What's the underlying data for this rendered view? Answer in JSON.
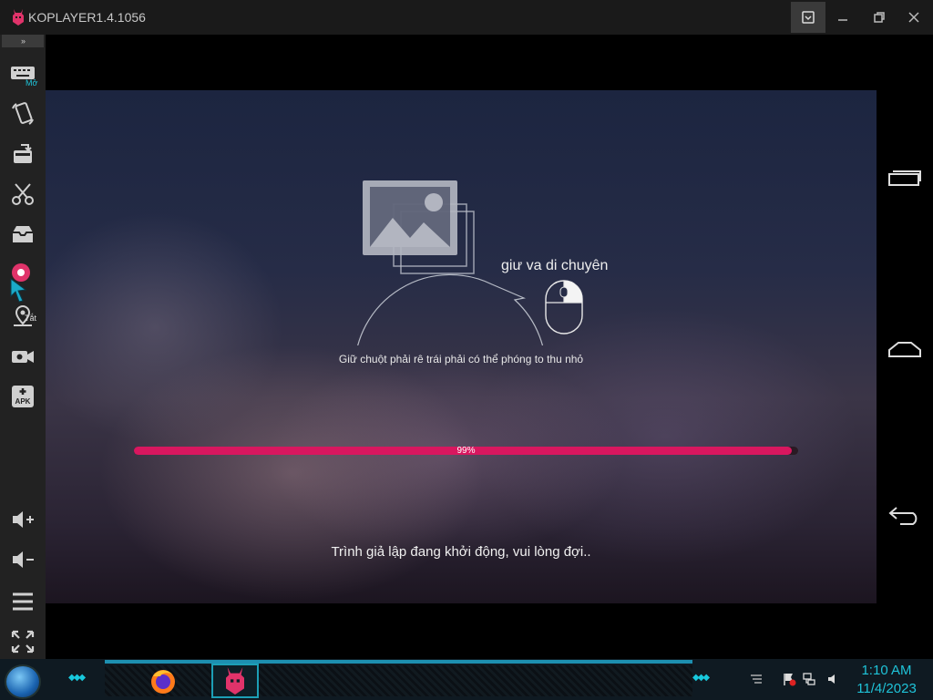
{
  "window": {
    "title": "KOPLAYER1.4.1056"
  },
  "sidebar": {
    "collapse_label": "››",
    "items": [
      {
        "name": "keyboard",
        "badge": "Mở"
      },
      {
        "name": "rotate"
      },
      {
        "name": "screen-switch"
      },
      {
        "name": "screenshot"
      },
      {
        "name": "share-folder"
      },
      {
        "name": "gamepad",
        "badge": "Tắt"
      },
      {
        "name": "location"
      },
      {
        "name": "video-record"
      },
      {
        "name": "install-apk",
        "text": "APK"
      },
      {
        "name": "volume-up"
      },
      {
        "name": "volume-down"
      },
      {
        "name": "menu"
      },
      {
        "name": "fullscreen"
      }
    ]
  },
  "screen": {
    "drag_label": "giư va di chuyên",
    "hint": "Giữ chuột phải rê trái phải có thể phóng to thu nhỏ",
    "progress": {
      "value": 0.99,
      "label": "99%"
    },
    "status": "Trình giả lập đang khởi động, vui lòng đợi.."
  },
  "rightnav": [
    "recent-apps",
    "home",
    "back"
  ],
  "taskbar": {
    "time": "1:10 AM",
    "date": "11/4/2023"
  },
  "colors": {
    "accent": "#d8175f",
    "cyan": "#1fc3d8",
    "titlebar": "#1a1a1a",
    "sidebar": "#222222"
  }
}
